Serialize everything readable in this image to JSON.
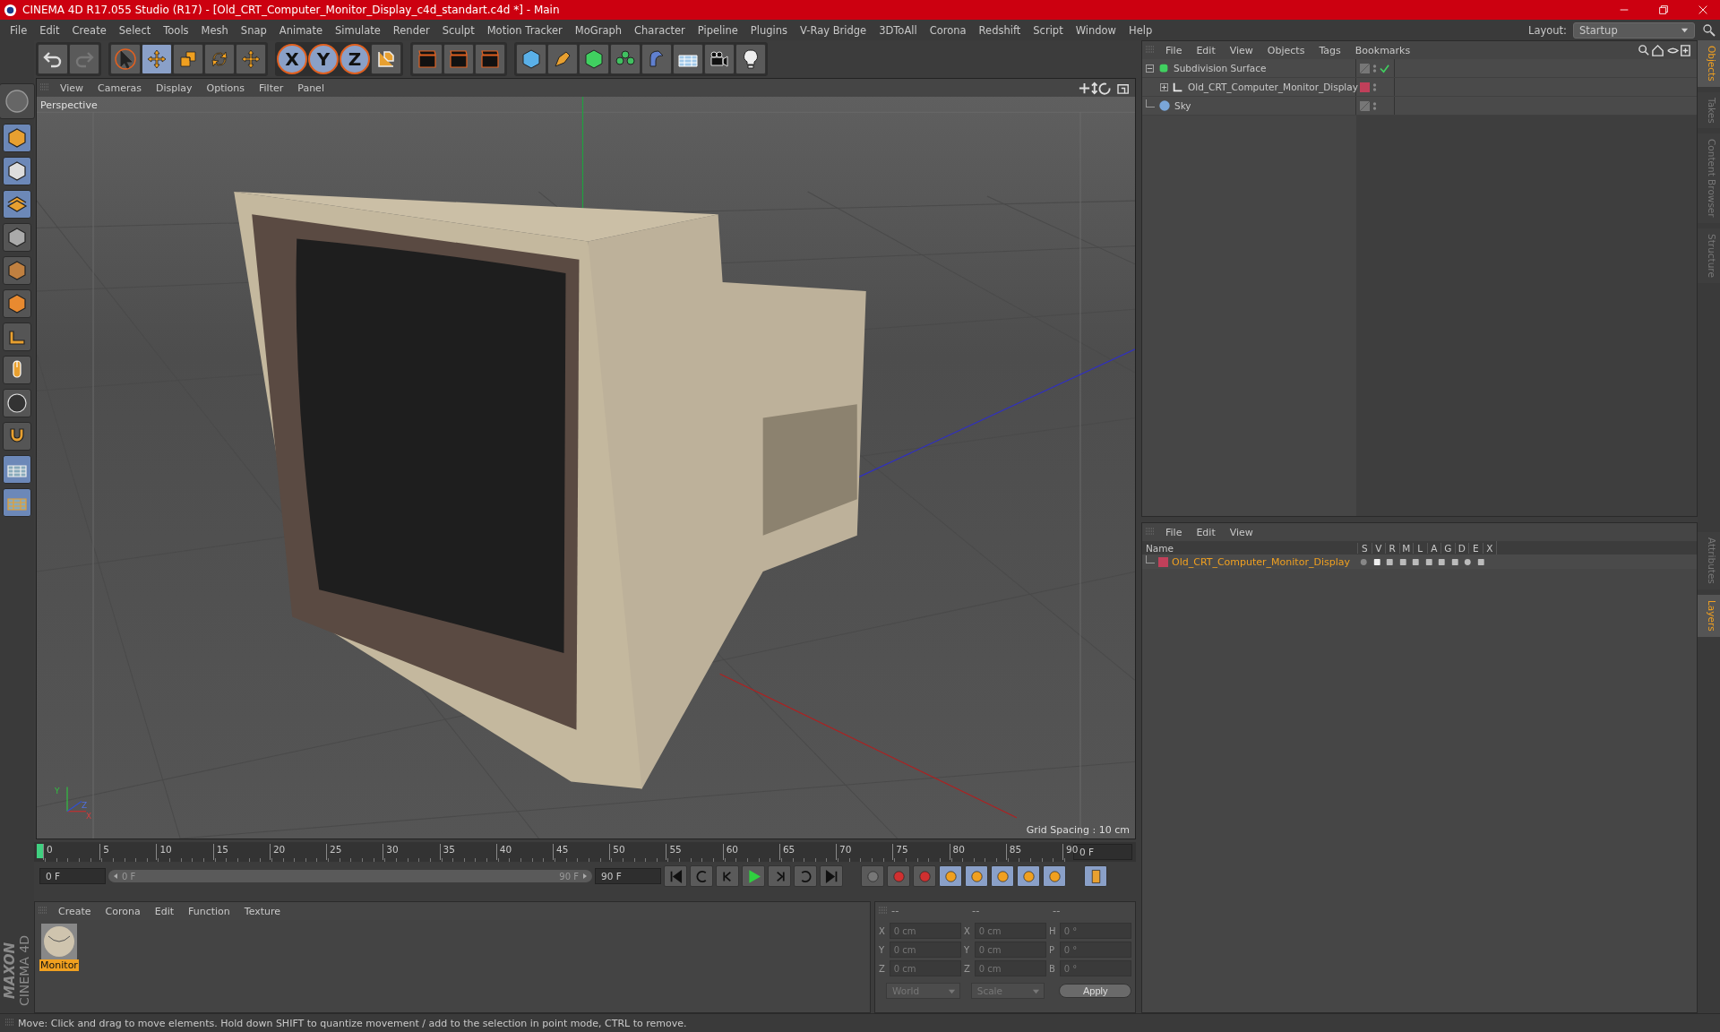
{
  "window": {
    "title": "CINEMA 4D R17.055 Studio (R17) - [Old_CRT_Computer_Monitor_Display_c4d_standart.c4d *] - Main"
  },
  "menu": [
    "File",
    "Edit",
    "Create",
    "Select",
    "Tools",
    "Mesh",
    "Snap",
    "Animate",
    "Simulate",
    "Render",
    "Sculpt",
    "Motion Tracker",
    "MoGraph",
    "Character",
    "Pipeline",
    "Plugins",
    "V-Ray Bridge",
    "3DToAll",
    "Corona",
    "Redshift",
    "Script",
    "Window",
    "Help"
  ],
  "layout": {
    "label": "Layout:",
    "value": "Startup"
  },
  "toolbar": {
    "axis_buttons": [
      "X",
      "Y",
      "Z"
    ]
  },
  "viewport": {
    "menu": [
      "View",
      "Cameras",
      "Display",
      "Options",
      "Filter",
      "Panel"
    ],
    "camera": "Perspective",
    "grid_spacing": "Grid Spacing : 10 cm",
    "axis_labels": [
      "Y",
      "Z",
      "X"
    ]
  },
  "timeline": {
    "ticks": [
      "0",
      "5",
      "10",
      "15",
      "20",
      "25",
      "30",
      "35",
      "40",
      "45",
      "50",
      "55",
      "60",
      "65",
      "70",
      "75",
      "80",
      "85",
      "90"
    ],
    "current_frame": "0 F",
    "start": "0 F",
    "range": {
      "start": "0 F",
      "end": "90 F",
      "level": 1
    },
    "end": "90 F"
  },
  "material_manager": {
    "menu": [
      "Create",
      "Corona",
      "Edit",
      "Function",
      "Texture"
    ],
    "materials": [
      {
        "name": "Monitor",
        "selected": true
      }
    ]
  },
  "coordinates": {
    "headers": [
      "--",
      "--",
      "--"
    ],
    "rows": [
      {
        "a": "X",
        "av": "0 cm",
        "b": "X",
        "bv": "0 cm",
        "c": "H",
        "cv": "0 °"
      },
      {
        "a": "Y",
        "av": "0 cm",
        "b": "Y",
        "bv": "0 cm",
        "c": "P",
        "cv": "0 °"
      },
      {
        "a": "Z",
        "av": "0 cm",
        "b": "Z",
        "bv": "0 cm",
        "c": "B",
        "cv": "0 °"
      }
    ],
    "dropdowns": [
      "World",
      "Scale"
    ],
    "apply": "Apply"
  },
  "object_manager": {
    "menu": [
      "File",
      "Edit",
      "View",
      "Objects",
      "Tags",
      "Bookmarks"
    ],
    "objects": [
      {
        "name": "Subdivision Surface",
        "kind": "subdivision",
        "expanded": true,
        "children": [
          {
            "name": "Old_CRT_Computer_Monitor_Display",
            "kind": "null",
            "expanded": false,
            "color": "#c0405a"
          }
        ]
      },
      {
        "name": "Sky",
        "kind": "sky"
      }
    ]
  },
  "layer_manager": {
    "menu": [
      "File",
      "Edit",
      "View"
    ],
    "columns": [
      "Name",
      "S",
      "V",
      "R",
      "M",
      "L",
      "A",
      "G",
      "D",
      "E",
      "X"
    ],
    "layers": [
      {
        "name": "Old_CRT_Computer_Monitor_Display",
        "color": "#c0405a"
      }
    ]
  },
  "side_tabs_top": [
    {
      "label": "Objects",
      "selected": true
    },
    {
      "label": "Takes",
      "selected": false
    },
    {
      "label": "Content Browser",
      "selected": false
    },
    {
      "label": "Structure",
      "selected": false
    }
  ],
  "side_tabs_bottom": [
    {
      "label": "Attributes",
      "selected": false
    },
    {
      "label": "Layers",
      "selected": true
    }
  ],
  "logo": {
    "brand": "MAXON",
    "product": "CINEMA 4D"
  },
  "status_bar": "Move: Click and drag to move elements. Hold down SHIFT to quantize movement / add to the selection in point mode, CTRL to remove."
}
